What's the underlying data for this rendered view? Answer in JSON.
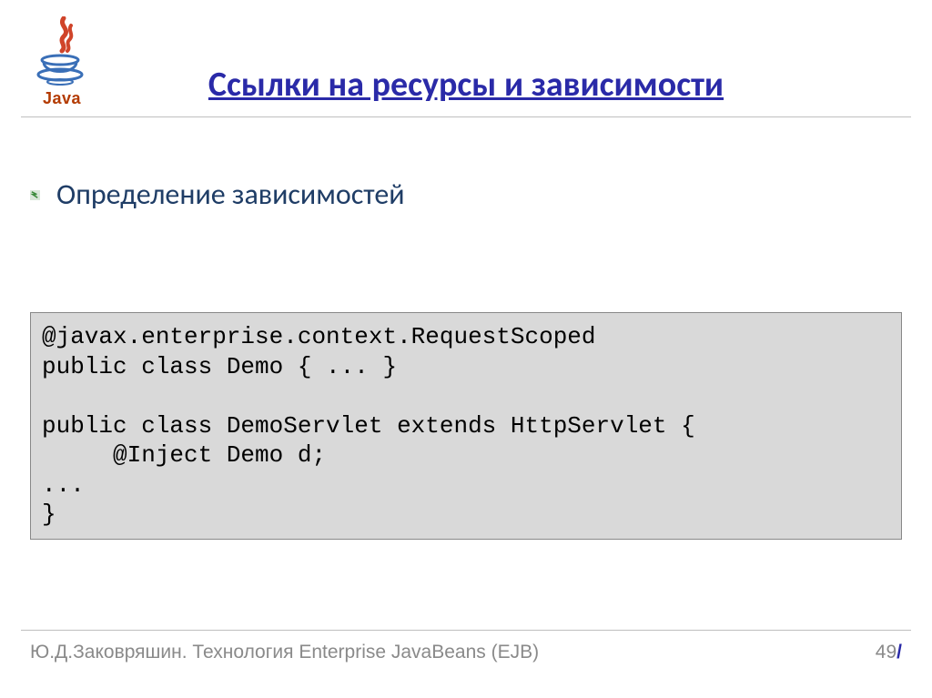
{
  "logo_text": "Java",
  "title": "Ссылки на ресурсы и зависимости",
  "bullet": "Определение зависимостей",
  "code": "@javax.enterprise.context.RequestScoped\npublic class Demo { ... }\n\npublic class DemoServlet extends HttpServlet {\n     @Inject Demo d;\n...\n}",
  "footer_left": "Ю.Д.Заковряшин. Технология Enterprise JavaBeans (EJB)",
  "page_number": "49",
  "page_slash": "/"
}
